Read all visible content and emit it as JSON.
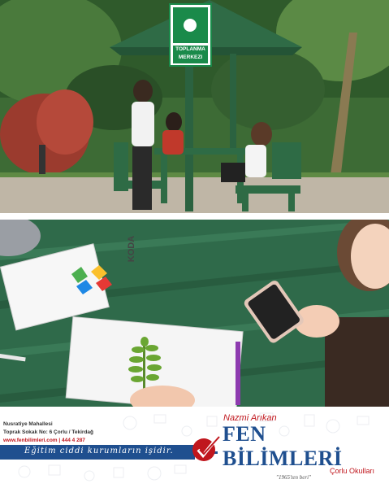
{
  "sign": {
    "line1": "TOPLANMA",
    "line2": "MERKEZI"
  },
  "notebook": {
    "brand": "KODA"
  },
  "footer": {
    "address_line1": "Nusratiye Mahallesi",
    "address_line2": "Toprak Sokak No: 6  Çorlu / Tekirdağ",
    "address_line3": "www.fenbilimleri.com | 444 4 287",
    "slogan": "Eğitim ciddi kurumların işidir.",
    "brand_top": "Nazmi Arıkan",
    "brand_main": "FEN BİLİMLERİ",
    "brand_since": "\"1965'ten beri\"",
    "brand_city": "Çorlu Okulları"
  },
  "colors": {
    "brand_blue": "#1f4f8f",
    "brand_red": "#c0161d",
    "sign_green": "#1a8a4a",
    "table_green": "#2e6b45"
  }
}
